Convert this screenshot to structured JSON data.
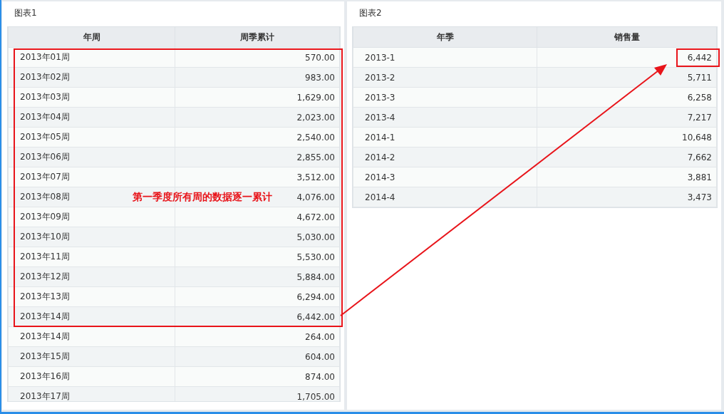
{
  "panels": [
    {
      "title": "图表1",
      "columns": [
        "年周",
        "周季累计"
      ],
      "rows": [
        [
          "2013年01周",
          "570.00"
        ],
        [
          "2013年02周",
          "983.00"
        ],
        [
          "2013年03周",
          "1,629.00"
        ],
        [
          "2013年04周",
          "2,023.00"
        ],
        [
          "2013年05周",
          "2,540.00"
        ],
        [
          "2013年06周",
          "2,855.00"
        ],
        [
          "2013年07周",
          "3,512.00"
        ],
        [
          "2013年08周",
          "4,076.00"
        ],
        [
          "2013年09周",
          "4,672.00"
        ],
        [
          "2013年10周",
          "5,030.00"
        ],
        [
          "2013年11周",
          "5,530.00"
        ],
        [
          "2013年12周",
          "5,884.00"
        ],
        [
          "2013年13周",
          "6,294.00"
        ],
        [
          "2013年14周",
          "6,442.00"
        ],
        [
          "2013年14周",
          "264.00"
        ],
        [
          "2013年15周",
          "604.00"
        ],
        [
          "2013年16周",
          "874.00"
        ],
        [
          "2013年17周",
          "1,705.00"
        ]
      ]
    },
    {
      "title": "图表2",
      "columns": [
        "年季",
        "销售量"
      ],
      "rows": [
        [
          "2013-1",
          "6,442"
        ],
        [
          "2013-2",
          "5,711"
        ],
        [
          "2013-3",
          "6,258"
        ],
        [
          "2013-4",
          "7,217"
        ],
        [
          "2014-1",
          "10,648"
        ],
        [
          "2014-2",
          "7,662"
        ],
        [
          "2014-3",
          "3,881"
        ],
        [
          "2014-4",
          "3,473"
        ]
      ]
    }
  ],
  "annotation": {
    "text": "第一季度所有周的数据逐一累计"
  }
}
